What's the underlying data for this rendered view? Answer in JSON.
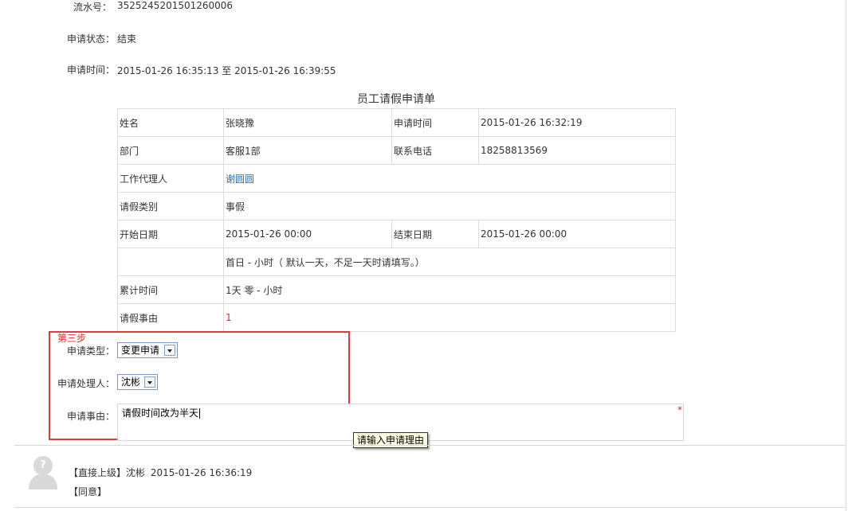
{
  "header": {
    "serial_label": "流水号",
    "serial_value": "3525245201501260006",
    "status_label": "申请状态",
    "status_value": "结束",
    "time_label": "申请时间",
    "time_value": "2015-01-26 16:35:13 至 2015-01-26 16:39:55"
  },
  "form": {
    "title": "员工请假申请单",
    "name_label": "姓名",
    "name_value": "张晓豫",
    "apply_time_label": "申请时间",
    "apply_time_value": "2015-01-26 16:32:19",
    "dept_label": "部门",
    "dept_value": "客服1部",
    "phone_label": "联系电话",
    "phone_value": "18258813569",
    "agent_label": "工作代理人",
    "agent_value": "谢圆圆",
    "type_label": "请假类别",
    "type_value": "事假",
    "start_label": "开始日期",
    "start_value": "2015-01-26 00:00",
    "end_label": "结束日期",
    "end_value": "2015-01-26 00:00",
    "first_day_note": "首日 - 小时（ 默认一天，不足一天时请填写。）",
    "total_label": "累计时间",
    "total_value": "1天 零 - 小时",
    "reason_label": "请假事由",
    "reason_value": "1"
  },
  "step3": {
    "title": "第三步",
    "request_type_label": "申请类型",
    "request_type_value": "变更申请",
    "handler_label": "申请处理人",
    "handler_value": "沈彬",
    "reason_label": "申请事由",
    "reason_value": "请假时间改为半天",
    "required_mark": "*",
    "tooltip": "请输入申请理由"
  },
  "log": {
    "avatar_glyph": "?",
    "role": "【直接上级】沈彬",
    "time": "2015-01-26 16:36:19",
    "result": "【同意】"
  },
  "colors": {
    "highlight_border": "#e03c3c",
    "link": "#1f6fb2",
    "required": "#e02020"
  }
}
